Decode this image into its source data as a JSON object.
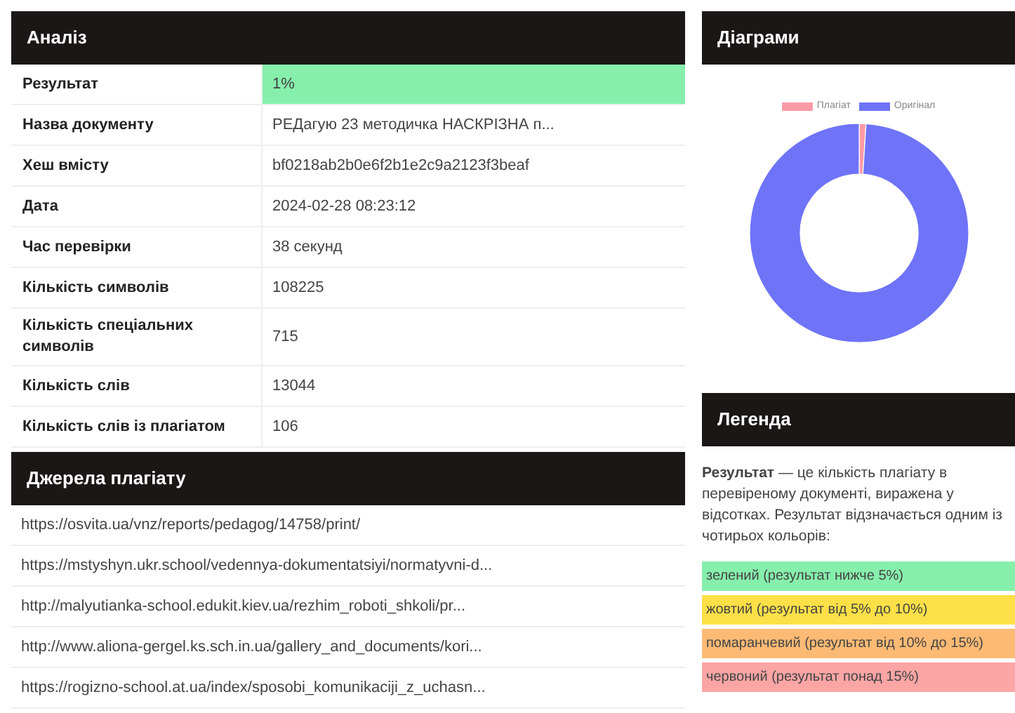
{
  "analysis": {
    "title": "Аналіз",
    "rows": [
      {
        "label": "Результат",
        "value": "1%",
        "color": "#86efac"
      },
      {
        "label": "Назва документу",
        "value": "РЕДагую 23 методичка НАСКРІЗНА п..."
      },
      {
        "label": "Хеш вмісту",
        "value": "bf0218ab2b0e6f2b1e2c9a2123f3beaf"
      },
      {
        "label": "Дата",
        "value": "2024-02-28 08:23:12"
      },
      {
        "label": "Час перевірки",
        "value": "38 секунд"
      },
      {
        "label": "Кількість символів",
        "value": "108225"
      },
      {
        "label": "Кількість спеціальних символів",
        "value": "715"
      },
      {
        "label": "Кількість слів",
        "value": "13044"
      },
      {
        "label": "Кількість слів із плагіатом",
        "value": "106"
      }
    ]
  },
  "sources": {
    "title": "Джерела плагіату",
    "links": [
      "https://osvita.ua/vnz/reports/pedagog/14758/print/",
      "https://mstyshyn.ukr.school/vedennya-dokumentatsiyi/normatyvni-d...",
      "http://malyutianka-school.edukit.kiev.ua/rezhim_roboti_shkoli/pr...",
      "http://www.aliona-gergel.ks.sch.in.ua/gallery_and_documents/kori...",
      "https://rogizno-school.at.ua/index/sposobi_komunikaciji_z_uchasn..."
    ]
  },
  "charts": {
    "title": "Діаграми",
    "chart_data": {
      "type": "donut",
      "legend": "top",
      "categories": [
        "Плагіат",
        "Оригінал"
      ],
      "colors": [
        "#ff9aa8",
        "#6f73f8"
      ],
      "values": [
        1,
        99
      ]
    }
  },
  "legend": {
    "title": "Легенда",
    "text": "**Результат** — це кількість плагіату в перевіреному документі, виражена у відсотках. Результат відзначається одним із чотирьох кольорів:",
    "items": [
      {
        "label": "зелений (результат нижче 5%)",
        "color": "#86efac"
      },
      {
        "label": "жовтий (результат від 5% до 10%)",
        "color": "#fde047"
      },
      {
        "label": "помаранчевий (результат від 10% до 15%)",
        "color": "#fdba74"
      },
      {
        "label": "червоний (результат понад 15%)",
        "color": "#fca5a5"
      }
    ]
  }
}
